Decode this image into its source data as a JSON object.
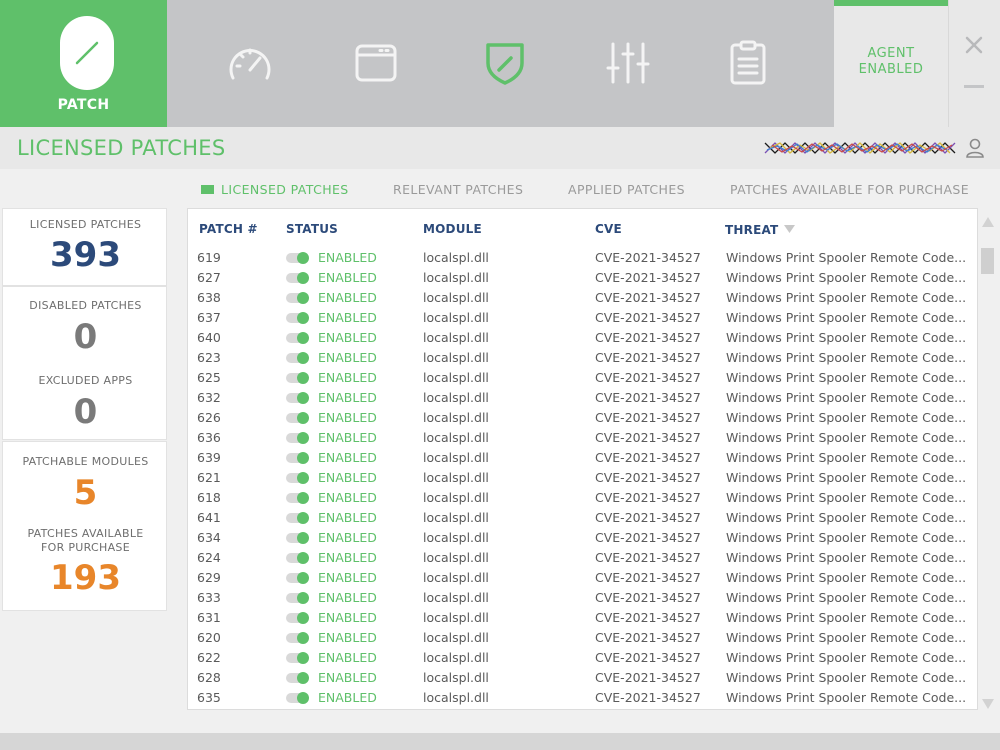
{
  "app": {
    "logo_label": "PATCH"
  },
  "nav": [
    {
      "icon": "speedometer-icon"
    },
    {
      "icon": "browser-window-icon"
    },
    {
      "icon": "shield-check-icon"
    },
    {
      "icon": "sliders-icon"
    },
    {
      "icon": "clipboard-icon"
    }
  ],
  "agent": {
    "line1": "AGENT",
    "line2": "ENABLED"
  },
  "header": {
    "title": "LICENSED PATCHES"
  },
  "tabs": [
    {
      "label": "LICENSED PATCHES",
      "active": true
    },
    {
      "label": "RELEVANT PATCHES",
      "active": false
    },
    {
      "label": "APPLIED PATCHES",
      "active": false
    },
    {
      "label": "PATCHES AVAILABLE FOR PURCHASE",
      "active": false
    }
  ],
  "stats": {
    "licensed": {
      "label": "LICENSED PATCHES",
      "value": "393"
    },
    "disabled": {
      "label": "DISABLED PATCHES",
      "value": "0"
    },
    "excluded": {
      "label": "EXCLUDED APPS",
      "value": "0"
    },
    "patchable": {
      "label": "PATCHABLE MODULES",
      "value": "5"
    },
    "purchase": {
      "label_line1": "PATCHES AVAILABLE",
      "label_line2": "FOR PURCHASE",
      "value": "193"
    }
  },
  "table": {
    "columns": {
      "patch": "PATCH #",
      "status": "STATUS",
      "module": "MODULE",
      "cve": "CVE",
      "threat": "THREAT"
    },
    "rows": [
      {
        "patch": "619",
        "status": "ENABLED",
        "module": "localspl.dll",
        "cve": "CVE-2021-34527",
        "threat": "Windows Print Spooler Remote Code..."
      },
      {
        "patch": "627",
        "status": "ENABLED",
        "module": "localspl.dll",
        "cve": "CVE-2021-34527",
        "threat": "Windows Print Spooler Remote Code..."
      },
      {
        "patch": "638",
        "status": "ENABLED",
        "module": "localspl.dll",
        "cve": "CVE-2021-34527",
        "threat": "Windows Print Spooler Remote Code..."
      },
      {
        "patch": "637",
        "status": "ENABLED",
        "module": "localspl.dll",
        "cve": "CVE-2021-34527",
        "threat": "Windows Print Spooler Remote Code..."
      },
      {
        "patch": "640",
        "status": "ENABLED",
        "module": "localspl.dll",
        "cve": "CVE-2021-34527",
        "threat": "Windows Print Spooler Remote Code..."
      },
      {
        "patch": "623",
        "status": "ENABLED",
        "module": "localspl.dll",
        "cve": "CVE-2021-34527",
        "threat": "Windows Print Spooler Remote Code..."
      },
      {
        "patch": "625",
        "status": "ENABLED",
        "module": "localspl.dll",
        "cve": "CVE-2021-34527",
        "threat": "Windows Print Spooler Remote Code..."
      },
      {
        "patch": "632",
        "status": "ENABLED",
        "module": "localspl.dll",
        "cve": "CVE-2021-34527",
        "threat": "Windows Print Spooler Remote Code..."
      },
      {
        "patch": "626",
        "status": "ENABLED",
        "module": "localspl.dll",
        "cve": "CVE-2021-34527",
        "threat": "Windows Print Spooler Remote Code..."
      },
      {
        "patch": "636",
        "status": "ENABLED",
        "module": "localspl.dll",
        "cve": "CVE-2021-34527",
        "threat": "Windows Print Spooler Remote Code..."
      },
      {
        "patch": "639",
        "status": "ENABLED",
        "module": "localspl.dll",
        "cve": "CVE-2021-34527",
        "threat": "Windows Print Spooler Remote Code..."
      },
      {
        "patch": "621",
        "status": "ENABLED",
        "module": "localspl.dll",
        "cve": "CVE-2021-34527",
        "threat": "Windows Print Spooler Remote Code..."
      },
      {
        "patch": "618",
        "status": "ENABLED",
        "module": "localspl.dll",
        "cve": "CVE-2021-34527",
        "threat": "Windows Print Spooler Remote Code..."
      },
      {
        "patch": "641",
        "status": "ENABLED",
        "module": "localspl.dll",
        "cve": "CVE-2021-34527",
        "threat": "Windows Print Spooler Remote Code..."
      },
      {
        "patch": "634",
        "status": "ENABLED",
        "module": "localspl.dll",
        "cve": "CVE-2021-34527",
        "threat": "Windows Print Spooler Remote Code..."
      },
      {
        "patch": "624",
        "status": "ENABLED",
        "module": "localspl.dll",
        "cve": "CVE-2021-34527",
        "threat": "Windows Print Spooler Remote Code..."
      },
      {
        "patch": "629",
        "status": "ENABLED",
        "module": "localspl.dll",
        "cve": "CVE-2021-34527",
        "threat": "Windows Print Spooler Remote Code..."
      },
      {
        "patch": "633",
        "status": "ENABLED",
        "module": "localspl.dll",
        "cve": "CVE-2021-34527",
        "threat": "Windows Print Spooler Remote Code..."
      },
      {
        "patch": "631",
        "status": "ENABLED",
        "module": "localspl.dll",
        "cve": "CVE-2021-34527",
        "threat": "Windows Print Spooler Remote Code..."
      },
      {
        "patch": "620",
        "status": "ENABLED",
        "module": "localspl.dll",
        "cve": "CVE-2021-34527",
        "threat": "Windows Print Spooler Remote Code..."
      },
      {
        "patch": "622",
        "status": "ENABLED",
        "module": "localspl.dll",
        "cve": "CVE-2021-34527",
        "threat": "Windows Print Spooler Remote Code..."
      },
      {
        "patch": "628",
        "status": "ENABLED",
        "module": "localspl.dll",
        "cve": "CVE-2021-34527",
        "threat": "Windows Print Spooler Remote Code..."
      },
      {
        "patch": "635",
        "status": "ENABLED",
        "module": "localspl.dll",
        "cve": "CVE-2021-34527",
        "threat": "Windows Print Spooler Remote Code..."
      }
    ]
  },
  "colors": {
    "brand_green": "#5fc06a",
    "topbar_gray": "#c4c5c7",
    "accent_blue": "#2c4a7a",
    "accent_orange": "#e8862a",
    "neutral_gray": "#7a7a7a"
  }
}
